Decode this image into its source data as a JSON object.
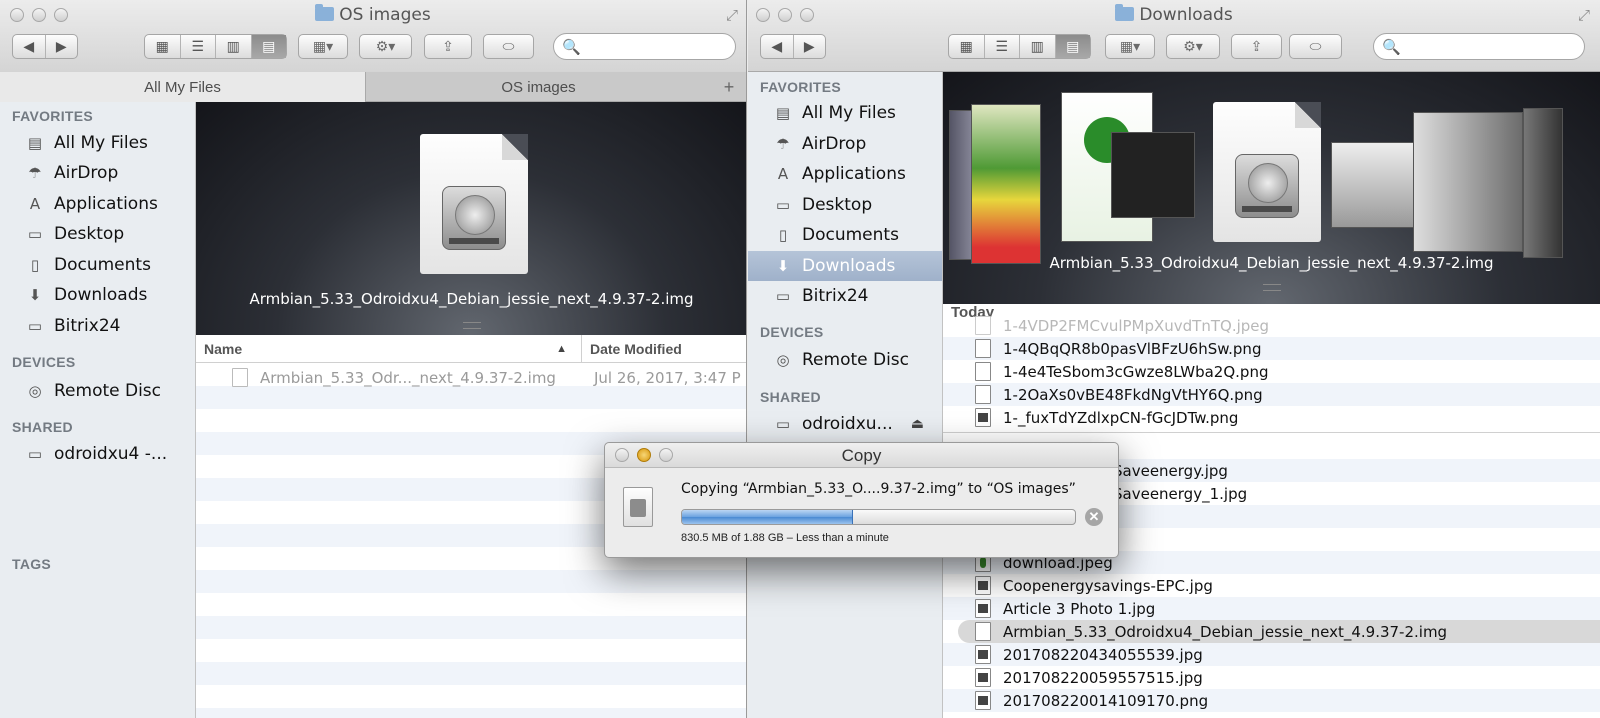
{
  "left": {
    "title": "OS images",
    "tabs": [
      "All My Files",
      "OS images"
    ],
    "tab_plus": "+",
    "search_placeholder": "",
    "sidebar": {
      "favorites_label": "FAVORITES",
      "favorites": [
        "All My Files",
        "AirDrop",
        "Applications",
        "Desktop",
        "Documents",
        "Downloads",
        "Bitrix24"
      ],
      "devices_label": "DEVICES",
      "devices": [
        "Remote Disc"
      ],
      "shared_label": "SHARED",
      "shared": [
        "odroidxu4 -..."
      ],
      "tags_label": "TAGS"
    },
    "cover_caption": "Armbian_5.33_Odroidxu4_Debian_jessie_next_4.9.37-2.img",
    "columns": {
      "name": "Name",
      "date": "Date Modified",
      "sort_arrow": "▲"
    },
    "files": [
      {
        "name": "Armbian_5.33_Odr..._next_4.9.37-2.img",
        "date": "Jul 26, 2017, 3:47 P"
      }
    ]
  },
  "right": {
    "title": "Downloads",
    "search_placeholder": "",
    "sidebar": {
      "favorites_label": "FAVORITES",
      "favorites": [
        "All My Files",
        "AirDrop",
        "Applications",
        "Desktop",
        "Documents",
        "Downloads",
        "Bitrix24"
      ],
      "selected": "Downloads",
      "devices_label": "DEVICES",
      "devices": [
        "Remote Disc"
      ],
      "shared_label": "SHARED",
      "shared": [
        "odroidxu..."
      ],
      "eject": "⏏"
    },
    "cover_caption": "Armbian_5.33_Odroidxu4_Debian_jessie_next_4.9.37-2.img",
    "group_label": "Today",
    "files_top": [
      "1-4VDP2FMCvulPMpXuvdTnTQ.jpeg",
      "1-4QBqQR8b0pasVlBFzU6hSw.png",
      "1-4e4TeSbom3cGwze8LWba2Q.png",
      "1-2OaXs0vBE48FkdNgVtHY6Q.png",
      "1-_fuxTdYZdlxpCN-fGcJDTw.png"
    ],
    "files_mid": [
      "Saveenergy.jpg",
      "Saveenergy_1.jpg"
    ],
    "files_bottom": [
      "download.jpeg",
      "Coopenergysavings-EPC.jpg",
      "Article 3 Photo 1.jpg",
      "Armbian_5.33_Odroidxu4_Debian_jessie_next_4.9.37-2.img",
      "201708220434055539.jpg",
      "201708220059557515.jpg",
      "201708220014109170.png"
    ],
    "selected_file": "Armbian_5.33_Odroidxu4_Debian_jessie_next_4.9.37-2.img"
  },
  "copy_dialog": {
    "title": "Copy",
    "message": "Copying “Armbian_5.33_O....9.37-2.img” to “OS images”",
    "progress_fraction": 0.435,
    "status": "830.5 MB of 1.88 GB – Less than a minute",
    "cancel_glyph": "✕"
  },
  "icons": {
    "back": "◀",
    "forward": "▶",
    "view_icon": "▦",
    "view_list": "☰",
    "view_columns": "▥",
    "view_coverflow": "▤",
    "arrange": "▦▾",
    "action": "⚙▾",
    "share": "⇪",
    "tag": "⬭",
    "search": "🔍",
    "expand": "⤢"
  }
}
